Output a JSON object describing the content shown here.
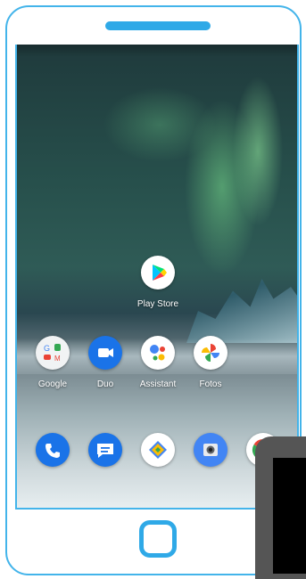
{
  "home_screen": {
    "center_app": {
      "label": "Play Store",
      "icon": "play-store-icon"
    },
    "row_apps": [
      {
        "label": "Google",
        "icon": "google-folder-icon"
      },
      {
        "label": "Duo",
        "icon": "duo-video-icon"
      },
      {
        "label": "Assistant",
        "icon": "assistant-icon"
      },
      {
        "label": "Fotos",
        "icon": "photos-pinwheel-icon"
      }
    ],
    "dock_apps": [
      {
        "icon": "phone-icon"
      },
      {
        "icon": "messages-icon"
      },
      {
        "icon": "files-icon"
      },
      {
        "icon": "camera-icon"
      },
      {
        "icon": "chrome-icon"
      }
    ]
  },
  "colors": {
    "frame_accent": "#2fa9e7",
    "phone_blue": "#1a73e8",
    "duo_blue": "#1a73e8",
    "wallpaper_green": "#7fe39b"
  }
}
